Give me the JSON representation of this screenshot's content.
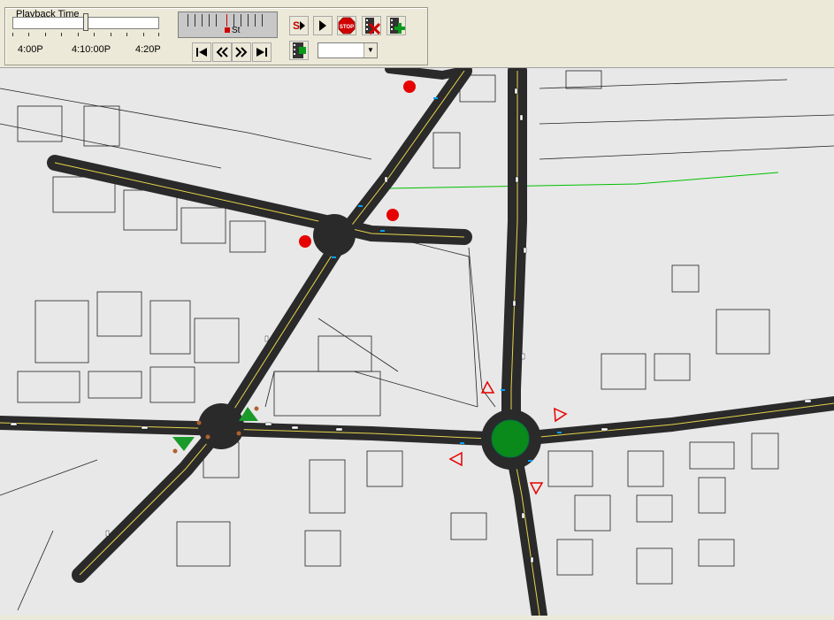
{
  "playback": {
    "title": "Playback Time",
    "time_labels": [
      "4:00P",
      "4:10:00P",
      "4:20P"
    ],
    "speed_label": "St"
  },
  "toolbar": {
    "stop_label": "STOP",
    "step_label": "S",
    "combo_value": ""
  },
  "colors": {
    "road": "#2a2a2a",
    "lane_line": "#e6d54a",
    "signal_red": "#e60000",
    "roundabout": "#0a8a1a",
    "toolbar_bg": "#ece9d8",
    "map_bg": "#e8e8e8"
  }
}
